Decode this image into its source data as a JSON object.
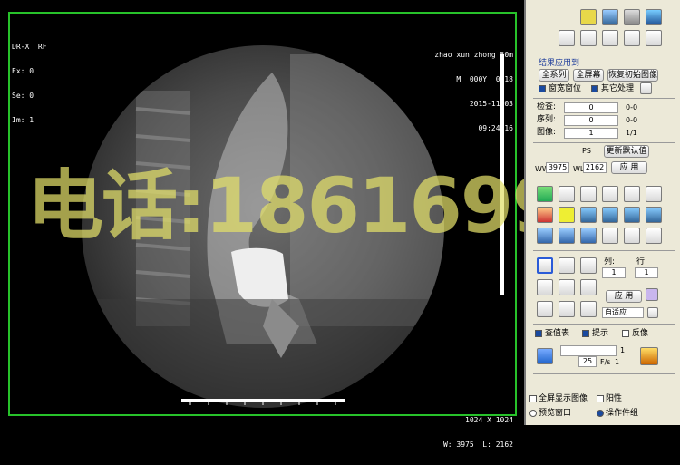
{
  "viewer": {
    "top_left": [
      "DR-X  RF",
      "Ex: 0",
      "Se: 0",
      "Im: 1"
    ],
    "top_right": [
      "zhao xun zhong 50m",
      "M  000Y  0018",
      "2015-11-03",
      "09:24.16"
    ],
    "bottom_right": [
      "1024 X 1024",
      "W: 3975  L: 2162"
    ],
    "watermark": "电话:1861699"
  },
  "panel": {
    "section_title": "结果应用到",
    "btn_all_series": "全系列",
    "btn_full_screen": "全屏幕",
    "btn_restore": "恢复初始图像",
    "chk_window": "窗宽窗位",
    "chk_other": "其它处理",
    "row_exam": {
      "label": "检查:",
      "value": "0",
      "range": "0-0"
    },
    "row_series": {
      "label": "序列:",
      "value": "0",
      "range": "0-0"
    },
    "row_image": {
      "label": "图像:",
      "value": "1",
      "range": "1/1"
    },
    "ps": "PS",
    "btn_refresh_default": "更新默认值",
    "ww_label": "WW",
    "ww_value": "3975",
    "wl_label": "WL",
    "wl_value": "2162",
    "btn_apply": "应 用",
    "col_label": "列:",
    "col_value": "1",
    "row_label": "行:",
    "row_value": "1",
    "btn_apply2": "应 用",
    "select_fit": "自适应",
    "chk_lookup": "查值表",
    "chk_hint": "提示",
    "chk_invert": "反像",
    "play_value": "1",
    "fps_value": "25",
    "fps_unit": "F/s",
    "fps_end": "1",
    "chk_fullscreen_display": "全屏显示图像",
    "chk_positive": "阳性",
    "radio_preview": "预览窗口",
    "radio_operate": "操作件组"
  }
}
